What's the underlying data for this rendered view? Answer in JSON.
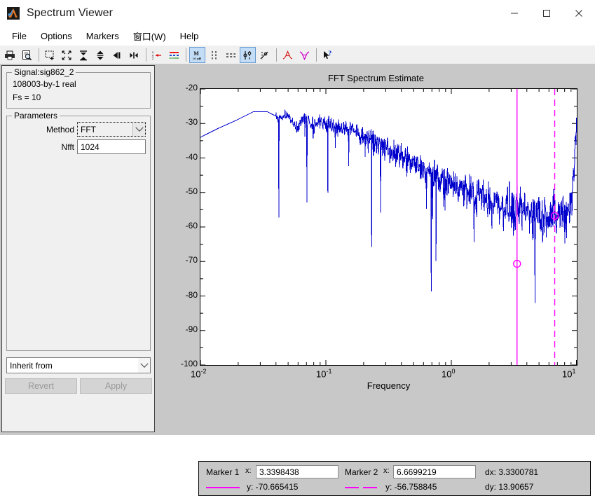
{
  "window": {
    "title": "Spectrum Viewer",
    "icon": "matlab-logo-icon",
    "minimize": "—",
    "maximize": "☐",
    "close": "✕"
  },
  "menubar": {
    "items": [
      {
        "label": "File",
        "name": "menu-file"
      },
      {
        "label": "Options",
        "name": "menu-options"
      },
      {
        "label": "Markers",
        "name": "menu-markers"
      },
      {
        "label": "窗口(W)",
        "name": "menu-window"
      },
      {
        "label": "Help",
        "name": "menu-help"
      }
    ]
  },
  "toolbar": {
    "buttons": [
      {
        "name": "print-icon",
        "pressed": false
      },
      {
        "name": "print-preview-icon",
        "pressed": false
      },
      {
        "sep": true
      },
      {
        "name": "zoom-in-region-icon",
        "pressed": false
      },
      {
        "name": "zoom-out-full-icon",
        "pressed": false
      },
      {
        "name": "zoom-vertical-in-icon",
        "pressed": false
      },
      {
        "name": "zoom-vertical-out-icon",
        "pressed": false
      },
      {
        "name": "zoom-horizontal-in-icon",
        "pressed": false
      },
      {
        "name": "zoom-horizontal-out-icon",
        "pressed": false
      },
      {
        "sep": true
      },
      {
        "name": "axis-labels-icon",
        "pressed": false
      },
      {
        "name": "line-style-icon",
        "pressed": false
      },
      {
        "sep": true
      },
      {
        "name": "markers-on-off-icon",
        "pressed": true
      },
      {
        "name": "marker-vertical-icon",
        "pressed": false
      },
      {
        "name": "marker-horizontal-icon",
        "pressed": false
      },
      {
        "name": "marker-track-icon",
        "pressed": true
      },
      {
        "name": "marker-slope-icon",
        "pressed": false
      },
      {
        "sep": true
      },
      {
        "name": "peak-finder-icon",
        "pressed": false
      },
      {
        "name": "valley-finder-icon",
        "pressed": false
      },
      {
        "sep": true
      },
      {
        "name": "context-help-icon",
        "pressed": false
      }
    ]
  },
  "left_panel": {
    "signal_group": {
      "title": "Signal:sig862_2",
      "lines": [
        "108003-by-1 real",
        "Fs = 10"
      ]
    },
    "parameters_group": {
      "title": "Parameters",
      "method_label": "Method",
      "method_value": "FFT",
      "nfft_label": "Nfft",
      "nfft_value": "1024"
    },
    "inherit_dropdown": {
      "value": "Inherit from"
    },
    "revert_button": "Revert",
    "apply_button": "Apply"
  },
  "markers": {
    "marker1": {
      "label": "Marker 1",
      "x_label": "x:",
      "x_value": "3.3398438",
      "y_label": "y: -70.665415",
      "line_style": "solid",
      "color": "#ff00ff"
    },
    "marker2": {
      "label": "Marker 2",
      "x_label": "x:",
      "x_value": "6.6699219",
      "y_label": "y: -56.758845",
      "line_style": "dashed",
      "color": "#ff00ff"
    },
    "dx": "dx: 3.3300781",
    "dy": "dy: 13.90657"
  },
  "chart_data": {
    "type": "line",
    "title": "FFT Spectrum Estimate",
    "xlabel": "Frequency",
    "ylabel": "",
    "xscale": "log",
    "xlim": [
      0.01,
      10
    ],
    "ylim": [
      -100,
      -20
    ],
    "yticks": [
      -20,
      -30,
      -40,
      -50,
      -60,
      -70,
      -80,
      -90,
      -100
    ],
    "ytick_labels": [
      "-20",
      "-30",
      "-40",
      "-50",
      "-60",
      "-70",
      "-80",
      "-90",
      "-100"
    ],
    "xticks": [
      0.01,
      0.1,
      1,
      10
    ],
    "xtick_labels": [
      "10-2",
      "10-1",
      "100",
      "101"
    ],
    "grid": false,
    "legend": false,
    "series": [
      {
        "name": "FFT Spectrum Estimate",
        "color": "#0000cc",
        "anchors_x": [
          0.01,
          0.0137,
          0.0195,
          0.0264,
          0.0342,
          0.043,
          0.05,
          0.0586,
          0.0684,
          0.08,
          0.0977,
          0.12,
          0.14,
          0.17,
          0.2,
          0.25,
          0.3,
          0.4,
          0.5,
          0.7,
          1.0,
          1.5,
          2.0,
          3.0,
          4.0,
          5.0,
          6.0,
          7.0,
          8.0,
          8.8,
          9.3,
          9.6,
          9.9
        ],
        "anchors_y": [
          -34.0,
          -31.5,
          -29.0,
          -26.6,
          -26.6,
          -28.5,
          -27.0,
          -31.5,
          -28.0,
          -30.5,
          -29.5,
          -31.5,
          -31.0,
          -32.5,
          -33.5,
          -35.5,
          -37.5,
          -40.0,
          -42.0,
          -44.5,
          -47.5,
          -50.5,
          -52.5,
          -54.5,
          -55.5,
          -56.0,
          -56.3,
          -56.3,
          -56.0,
          -54.0,
          -49.0,
          -42.0,
          -31.0
        ],
        "noise_start_x": 0.04,
        "noise_amp_start": 1.5,
        "noise_amp_end": 8.0,
        "spike_amp": 18.0
      }
    ],
    "marker_lines": [
      {
        "name": "marker1",
        "x": 3.3398438,
        "y": -70.665415,
        "style": "solid",
        "color": "#ff00ff"
      },
      {
        "name": "marker2",
        "x": 6.6699219,
        "y": -56.758845,
        "style": "dashed",
        "color": "#ff00ff"
      }
    ]
  }
}
